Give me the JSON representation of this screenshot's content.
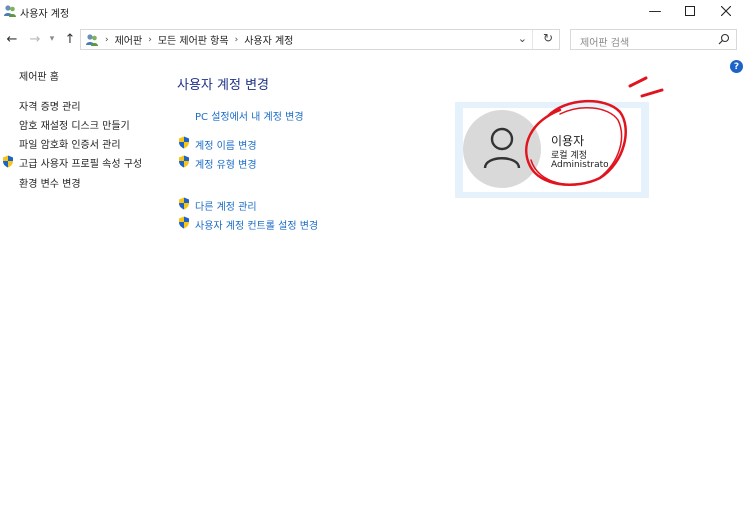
{
  "window": {
    "title": "사용자 계정",
    "controls": [
      "minimize-icon",
      "maximize-icon",
      "close-icon"
    ]
  },
  "address_bar": {
    "breadcrumbs": [
      "제어판",
      "모든 제어판 항목",
      "사용자 계정"
    ],
    "search_placeholder": "제어판 검색"
  },
  "left_nav": {
    "home": "제어판 홈",
    "items": [
      {
        "label": "자격 증명 관리",
        "shield": false
      },
      {
        "label": "암호 재설정 디스크 만들기",
        "shield": false
      },
      {
        "label": "파일 암호화 인증서 관리",
        "shield": false
      },
      {
        "label": "고급 사용자 프로필 속성 구성",
        "shield": true
      },
      {
        "label": "환경 변수 변경",
        "shield": false
      }
    ]
  },
  "main": {
    "title": "사용자 계정 변경",
    "pc_settings_link": "PC 설정에서 내 계정 변경",
    "links_group1": [
      "계정 이름 변경",
      "계정 유형 변경"
    ],
    "links_group2": [
      "다른 계정 관리",
      "사용자 계정 컨트롤 설정 변경"
    ]
  },
  "user": {
    "name": "이용자",
    "account_type": "로컬 계정",
    "role": "Administrator"
  },
  "colors": {
    "link": "#1c6cc6",
    "title": "#1e3287",
    "card_bg": "#e5f1fb",
    "annotation": "#e0141e"
  }
}
